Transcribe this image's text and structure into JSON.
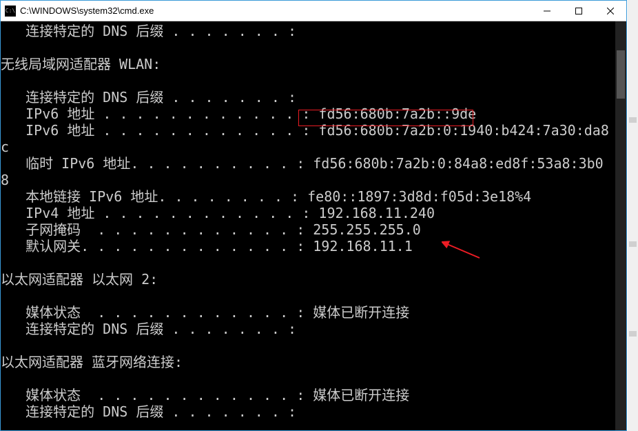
{
  "titlebar": {
    "icon_label": "C:\\",
    "title": "C:\\WINDOWS\\system32\\cmd.exe"
  },
  "window_controls": {
    "minimize": "minimize",
    "maximize": "maximize",
    "close": "close"
  },
  "console": {
    "lines": [
      "   连接特定的 DNS 后缀 . . . . . . . :",
      "",
      "无线局域网适配器 WLAN:",
      "",
      "   连接特定的 DNS 后缀 . . . . . . . :",
      "   IPv6 地址 . . . . . . . . . . . . : fd56:680b:7a2b::9de",
      "   IPv6 地址 . . . . . . . . . . . . : fd56:680b:7a2b:0:1940:b424:7a30:da8",
      "c",
      "   临时 IPv6 地址. . . . . . . . . . : fd56:680b:7a2b:0:84a8:ed8f:53a8:3b0",
      "8",
      "   本地链接 IPv6 地址. . . . . . . . : fe80::1897:3d8d:f05d:3e18%4",
      "   IPv4 地址 . . . . . . . . . . . . : 192.168.11.240",
      "   子网掩码  . . . . . . . . . . . . : 255.255.255.0",
      "   默认网关. . . . . . . . . . . . . : 192.168.11.1",
      "",
      "以太网适配器 以太网 2:",
      "",
      "   媒体状态  . . . . . . . . . . . . : 媒体已断开连接",
      "   连接特定的 DNS 后缀 . . . . . . . :",
      "",
      "以太网适配器 蓝牙网络连接:",
      "",
      "   媒体状态  . . . . . . . . . . . . : 媒体已断开连接",
      "   连接特定的 DNS 后缀 . . . . . . . :"
    ]
  },
  "annotations": {
    "highlight_ipv6": "fd56:680b:7a2b::9de",
    "arrow_target": "192.168.11.240",
    "highlight_color": "#ed1c24"
  }
}
